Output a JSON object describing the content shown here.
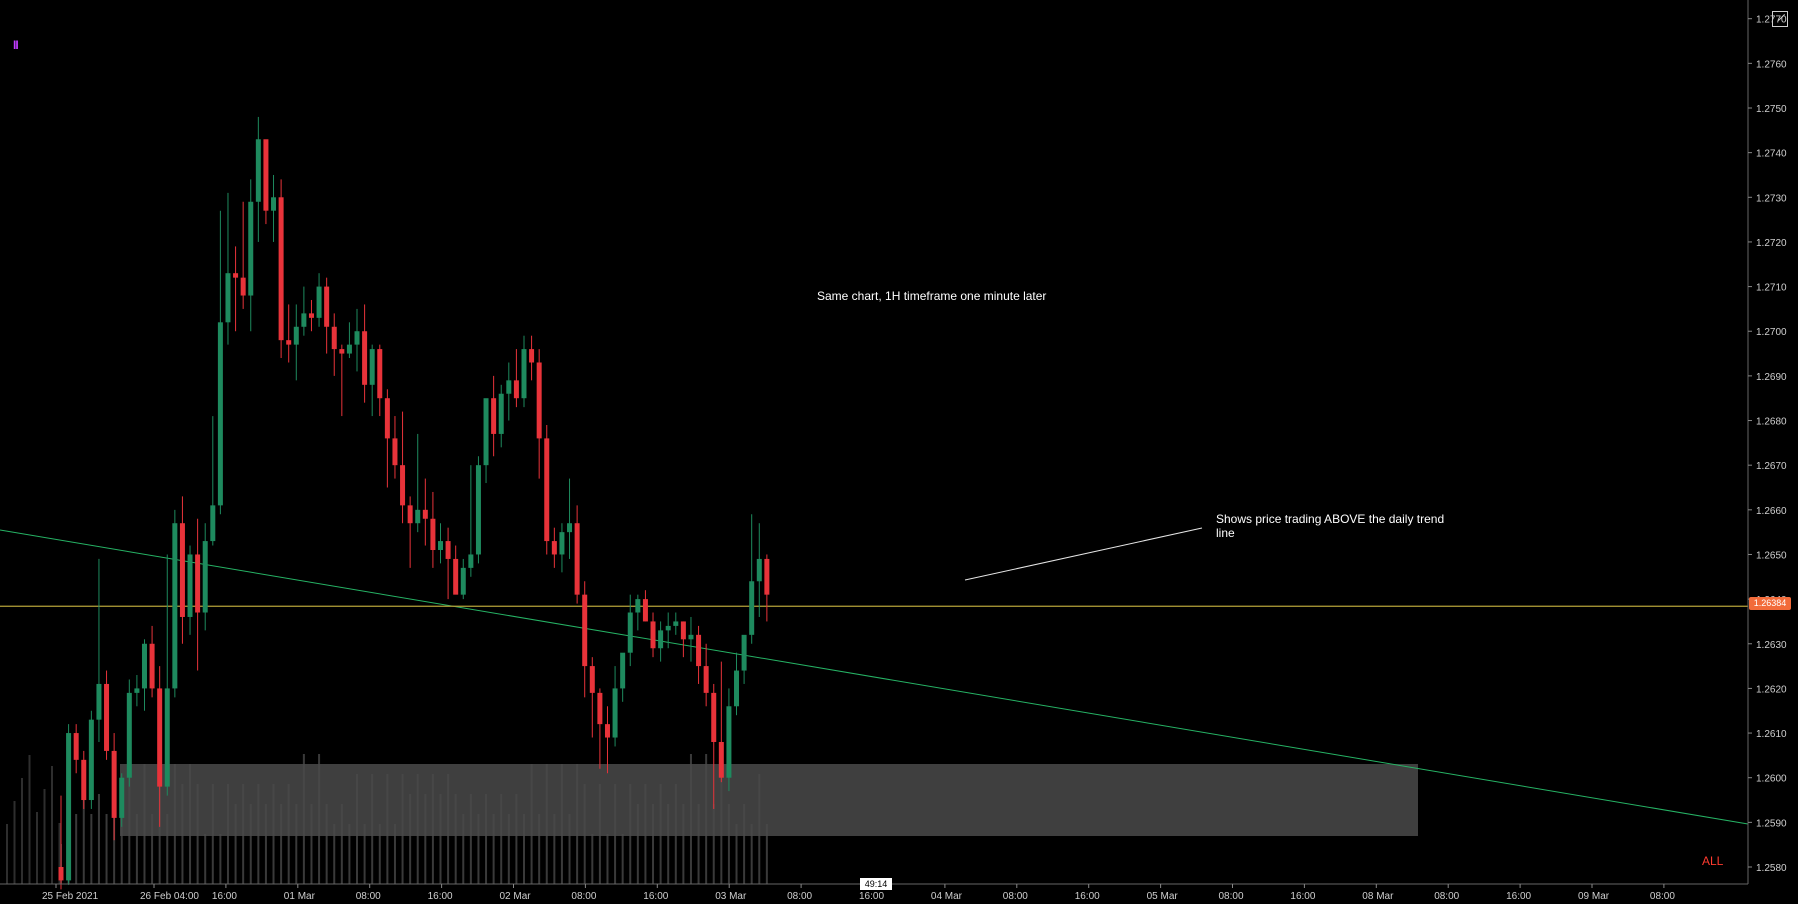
{
  "chart_data": {
    "type": "candlestick",
    "timeframe_note": "Same chart, 1H timeframe one minute later",
    "y_axis": {
      "ticks": [
        "1.2770",
        "1.2760",
        "1.2750",
        "1.2740",
        "1.2730",
        "1.2720",
        "1.2710",
        "1.2700",
        "1.2690",
        "1.2680",
        "1.2670",
        "1.2660",
        "1.2650",
        "1.2640",
        "1.2630",
        "1.2620",
        "1.2610",
        "1.2600",
        "1.2590",
        "1.2580"
      ],
      "ylim": [
        1.2575,
        1.2775
      ]
    },
    "x_axis": {
      "ticks": [
        "25 Feb 2021",
        "26 Feb 04:00",
        "16:00",
        "01 Mar",
        "08:00",
        "16:00",
        "02 Mar",
        "08:00",
        "16:00",
        "03 Mar",
        "08:00",
        "16:00",
        "04 Mar",
        "08:00",
        "16:00",
        "05 Mar",
        "08:00",
        "16:00",
        "08 Mar",
        "08:00",
        "16:00",
        "09 Mar",
        "08:00"
      ]
    },
    "current_price": "1.26384",
    "current_price_value": 1.26384,
    "countdown": "49:14",
    "candles": [
      [
        1.258,
        1.2596,
        1.2575,
        1.2577
      ],
      [
        1.2577,
        1.2612,
        1.2576,
        1.261
      ],
      [
        1.261,
        1.2612,
        1.2601,
        1.2604
      ],
      [
        1.2604,
        1.2606,
        1.2593,
        1.2595
      ],
      [
        1.2595,
        1.2615,
        1.2593,
        1.2613
      ],
      [
        1.2613,
        1.2649,
        1.2608,
        1.2621
      ],
      [
        1.2621,
        1.2624,
        1.2604,
        1.2606
      ],
      [
        1.2606,
        1.261,
        1.2586,
        1.2591
      ],
      [
        1.2591,
        1.2601,
        1.2589,
        1.26
      ],
      [
        1.26,
        1.2622,
        1.2598,
        1.2619
      ],
      [
        1.2619,
        1.2623,
        1.2616,
        1.262
      ],
      [
        1.262,
        1.2631,
        1.2615,
        1.263
      ],
      [
        1.263,
        1.2634,
        1.2618,
        1.262
      ],
      [
        1.262,
        1.2625,
        1.2589,
        1.2598
      ],
      [
        1.2598,
        1.265,
        1.2596,
        1.262
      ],
      [
        1.262,
        1.266,
        1.2618,
        1.2657
      ],
      [
        1.2657,
        1.2663,
        1.263,
        1.2636
      ],
      [
        1.2636,
        1.2652,
        1.2632,
        1.265
      ],
      [
        1.265,
        1.2658,
        1.2624,
        1.2637
      ],
      [
        1.2637,
        1.2657,
        1.2633,
        1.2653
      ],
      [
        1.2653,
        1.2681,
        1.2652,
        1.2661
      ],
      [
        1.2661,
        1.2727,
        1.2659,
        1.2702
      ],
      [
        1.2702,
        1.2731,
        1.2697,
        1.2713
      ],
      [
        1.2713,
        1.2719,
        1.27,
        1.2712
      ],
      [
        1.2712,
        1.2729,
        1.2705,
        1.2708
      ],
      [
        1.2708,
        1.2734,
        1.27,
        1.2729
      ],
      [
        1.2729,
        1.2748,
        1.272,
        1.2743
      ],
      [
        1.2743,
        1.2736,
        1.2724,
        1.2727
      ],
      [
        1.2727,
        1.2735,
        1.272,
        1.273
      ],
      [
        1.273,
        1.2734,
        1.2694,
        1.2698
      ],
      [
        1.2698,
        1.2706,
        1.2693,
        1.2697
      ],
      [
        1.2697,
        1.2706,
        1.2689,
        1.2701
      ],
      [
        1.2701,
        1.271,
        1.2699,
        1.2704
      ],
      [
        1.2704,
        1.2707,
        1.27,
        1.2703
      ],
      [
        1.2703,
        1.2713,
        1.2701,
        1.271
      ],
      [
        1.271,
        1.2712,
        1.2695,
        1.2701
      ],
      [
        1.2701,
        1.2704,
        1.269,
        1.2696
      ],
      [
        1.2696,
        1.2697,
        1.2681,
        1.2695
      ],
      [
        1.2695,
        1.2702,
        1.2694,
        1.2697
      ],
      [
        1.2697,
        1.2705,
        1.2691,
        1.27
      ],
      [
        1.27,
        1.2706,
        1.2684,
        1.2688
      ],
      [
        1.2688,
        1.2697,
        1.2681,
        1.2696
      ],
      [
        1.2696,
        1.2697,
        1.2681,
        1.2685
      ],
      [
        1.2685,
        1.2687,
        1.2665,
        1.2676
      ],
      [
        1.2676,
        1.2681,
        1.2667,
        1.267
      ],
      [
        1.267,
        1.2682,
        1.2657,
        1.2661
      ],
      [
        1.2661,
        1.2663,
        1.2647,
        1.2657
      ],
      [
        1.2657,
        1.2677,
        1.2655,
        1.266
      ],
      [
        1.266,
        1.2667,
        1.2652,
        1.2658
      ],
      [
        1.2658,
        1.2664,
        1.2647,
        1.2651
      ],
      [
        1.2651,
        1.2657,
        1.2648,
        1.2653
      ],
      [
        1.2653,
        1.2656,
        1.264,
        1.2649
      ],
      [
        1.2649,
        1.2652,
        1.2642,
        1.2641
      ],
      [
        1.2641,
        1.2649,
        1.264,
        1.2647
      ],
      [
        1.2647,
        1.267,
        1.2645,
        1.265
      ],
      [
        1.265,
        1.2672,
        1.2648,
        1.267
      ],
      [
        1.267,
        1.2678,
        1.2666,
        1.2685
      ],
      [
        1.2685,
        1.269,
        1.2672,
        1.2677
      ],
      [
        1.2677,
        1.2688,
        1.2674,
        1.2686
      ],
      [
        1.2686,
        1.2693,
        1.268,
        1.2689
      ],
      [
        1.2689,
        1.2696,
        1.2683,
        1.2685
      ],
      [
        1.2685,
        1.2699,
        1.2683,
        1.2696
      ],
      [
        1.2696,
        1.2699,
        1.2689,
        1.2693
      ],
      [
        1.2693,
        1.2696,
        1.2667,
        1.2676
      ],
      [
        1.2676,
        1.2679,
        1.265,
        1.2653
      ],
      [
        1.2653,
        1.2656,
        1.2647,
        1.265
      ],
      [
        1.265,
        1.2657,
        1.2646,
        1.2655
      ],
      [
        1.2655,
        1.2667,
        1.2649,
        1.2657
      ],
      [
        1.2657,
        1.2661,
        1.2639,
        1.2641
      ],
      [
        1.2641,
        1.2644,
        1.2618,
        1.2625
      ],
      [
        1.2625,
        1.2627,
        1.2609,
        1.2619
      ],
      [
        1.2619,
        1.262,
        1.2602,
        1.2612
      ],
      [
        1.2612,
        1.2616,
        1.2601,
        1.2609
      ],
      [
        1.2609,
        1.2625,
        1.2607,
        1.262
      ],
      [
        1.262,
        1.2624,
        1.2617,
        1.2628
      ],
      [
        1.2628,
        1.2641,
        1.2625,
        1.2637
      ],
      [
        1.2637,
        1.2641,
        1.2633,
        1.264
      ],
      [
        1.264,
        1.2642,
        1.2635,
        1.2635
      ],
      [
        1.2635,
        1.2637,
        1.2627,
        1.2629
      ],
      [
        1.2629,
        1.2635,
        1.2626,
        1.2633
      ],
      [
        1.2633,
        1.2637,
        1.2629,
        1.2634
      ],
      [
        1.2634,
        1.2637,
        1.2632,
        1.2635
      ],
      [
        1.2635,
        1.2635,
        1.2627,
        1.2631
      ],
      [
        1.2631,
        1.2636,
        1.2626,
        1.2632
      ],
      [
        1.2632,
        1.2634,
        1.2621,
        1.2625
      ],
      [
        1.2625,
        1.263,
        1.2616,
        1.2619
      ],
      [
        1.2619,
        1.2621,
        1.2593,
        1.2608
      ],
      [
        1.2608,
        1.2626,
        1.2599,
        1.26
      ],
      [
        1.26,
        1.262,
        1.2597,
        1.2616
      ],
      [
        1.2616,
        1.2628,
        1.2614,
        1.2624
      ],
      [
        1.2624,
        1.2629,
        1.2621,
        1.2632
      ],
      [
        1.2632,
        1.2659,
        1.263,
        1.2644
      ],
      [
        1.2644,
        1.2657,
        1.2636,
        1.2649
      ],
      [
        1.2649,
        1.265,
        1.2635,
        1.2641
      ]
    ]
  },
  "annotations": {
    "timeframe_note": "Same chart, 1H timeframe one minute later",
    "trend_note": "Shows price trading ABOVE the daily trend line"
  },
  "labels": {
    "all": "ALL",
    "current_price": "1.26384",
    "countdown": "49:14"
  },
  "colors": {
    "background": "#000000",
    "bull": "#1e8a5e",
    "bear": "#e8333a",
    "trend_line": "#26b365",
    "price_line": "#b5a23a",
    "zone": "#4a4a4a",
    "price_tag": "#f26b3a",
    "all_label": "#ff3b2f"
  }
}
